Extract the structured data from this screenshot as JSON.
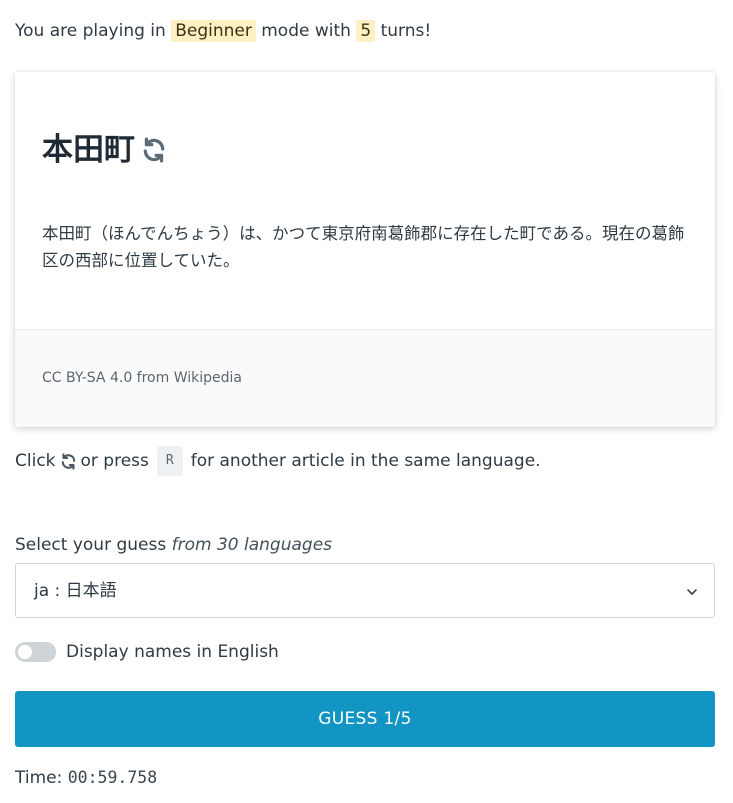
{
  "mode_line": {
    "prefix": "You are playing in",
    "mode": "Beginner",
    "middle": "mode with",
    "turns": "5",
    "suffix": "turns!"
  },
  "article": {
    "title": "本田町",
    "text": "本田町（ほんでんちょう）は、かつて東京府南葛飾郡に存在した町である。現在の葛飾区の西部に位置していた。",
    "source": "CC BY-SA 4.0 from Wikipedia"
  },
  "hint": {
    "click": "Click",
    "or_press": "or press",
    "key": "R",
    "rest": "for another article in the same language."
  },
  "select": {
    "label": "Select your guess",
    "label_em": "from 30 languages",
    "value": "ja : 日本語"
  },
  "toggle": {
    "label": "Display names in English",
    "on": false
  },
  "guess_button": {
    "label": "GUESS 1/5"
  },
  "timer": {
    "label": "Time:",
    "value": "00:59.758"
  },
  "colors": {
    "highlight": "#fdf0c2",
    "button": "#1395c3"
  }
}
